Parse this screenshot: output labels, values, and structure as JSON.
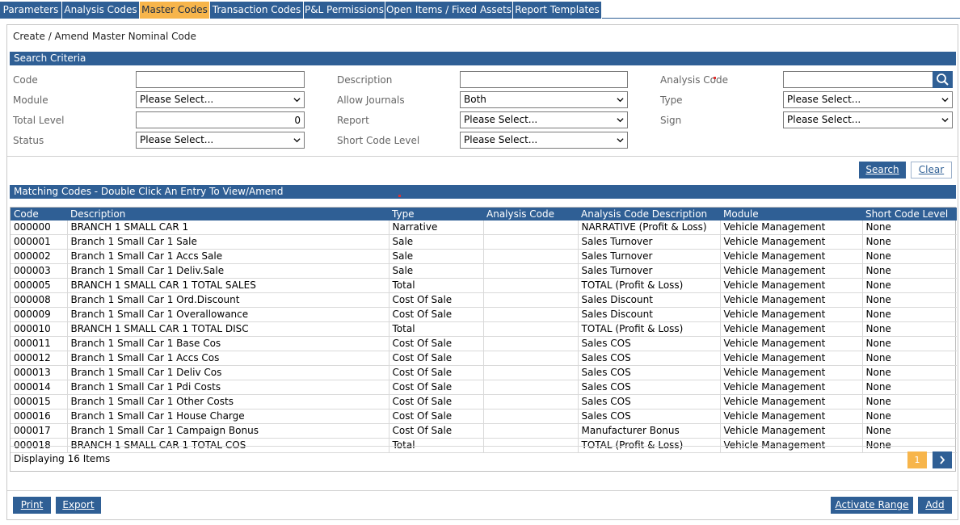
{
  "tabs": [
    {
      "label": "Parameters",
      "active": false
    },
    {
      "label": "Analysis Codes",
      "active": false
    },
    {
      "label": "Master Codes",
      "active": true
    },
    {
      "label": "Transaction Codes",
      "active": false
    },
    {
      "label": "P&L Permissions",
      "active": false
    },
    {
      "label": "Open Items / Fixed Assets",
      "active": false
    },
    {
      "label": "Report Templates",
      "active": false
    }
  ],
  "page_title": "Create / Amend Master Nominal Code",
  "search_criteria": {
    "header": "Search Criteria",
    "code": {
      "label": "Code",
      "value": ""
    },
    "description": {
      "label": "Description",
      "value": ""
    },
    "analysis_code": {
      "label": "Analysis Code",
      "value": ""
    },
    "module": {
      "label": "Module",
      "value": "Please Select..."
    },
    "allow_journals": {
      "label": "Allow Journals",
      "value": "Both"
    },
    "type": {
      "label": "Type",
      "value": "Please Select..."
    },
    "total_level": {
      "label": "Total Level",
      "value": "0"
    },
    "report": {
      "label": "Report",
      "value": "Please Select..."
    },
    "sign": {
      "label": "Sign",
      "value": "Please Select..."
    },
    "status": {
      "label": "Status",
      "value": "Please Select..."
    },
    "short_code_level": {
      "label": "Short Code Level",
      "value": "Please Select..."
    }
  },
  "actions": {
    "search_label": "Search",
    "clear_label": "Clear"
  },
  "matching": {
    "header": "Matching Codes - Double Click An Entry To View/Amend",
    "columns": [
      "Code",
      "Description",
      "Type",
      "Analysis Code",
      "Analysis Code Description",
      "Module",
      "Short Code Level"
    ],
    "rows": [
      [
        "000000",
        "BRANCH 1 SMALL CAR 1",
        "Narrative",
        "",
        "NARRATIVE (Profit & Loss)",
        "Vehicle Management",
        "None"
      ],
      [
        "000001",
        "Branch 1 Small Car 1 Sale",
        "Sale",
        "",
        "Sales Turnover",
        "Vehicle Management",
        "None"
      ],
      [
        "000002",
        "Branch 1 Small Car 1 Accs Sale",
        "Sale",
        "",
        "Sales Turnover",
        "Vehicle Management",
        "None"
      ],
      [
        "000003",
        "Branch 1 Small Car 1 Deliv.Sale",
        "Sale",
        "",
        "Sales Turnover",
        "Vehicle Management",
        "None"
      ],
      [
        "000005",
        "BRANCH 1 SMALL CAR 1 TOTAL SALES",
        "Total",
        "",
        "TOTAL (Profit & Loss)",
        "Vehicle Management",
        "None"
      ],
      [
        "000008",
        "Branch 1 Small Car 1 Ord.Discount",
        "Cost Of Sale",
        "",
        "Sales Discount",
        "Vehicle Management",
        "None"
      ],
      [
        "000009",
        "Branch 1 Small Car 1 Overallowance",
        "Cost Of Sale",
        "",
        "Sales Discount",
        "Vehicle Management",
        "None"
      ],
      [
        "000010",
        "BRANCH 1 SMALL CAR 1 TOTAL DISC",
        "Total",
        "",
        "TOTAL (Profit & Loss)",
        "Vehicle Management",
        "None"
      ],
      [
        "000011",
        "Branch 1 Small Car 1 Base Cos",
        "Cost Of Sale",
        "",
        "Sales COS",
        "Vehicle Management",
        "None"
      ],
      [
        "000012",
        "Branch 1 Small Car 1 Accs Cos",
        "Cost Of Sale",
        "",
        "Sales COS",
        "Vehicle Management",
        "None"
      ],
      [
        "000013",
        "Branch 1 Small Car 1 Deliv Cos",
        "Cost Of Sale",
        "",
        "Sales COS",
        "Vehicle Management",
        "None"
      ],
      [
        "000014",
        "Branch 1 Small Car 1 Pdi Costs",
        "Cost Of Sale",
        "",
        "Sales COS",
        "Vehicle Management",
        "None"
      ],
      [
        "000015",
        "Branch 1 Small Car 1 Other Costs",
        "Cost Of Sale",
        "",
        "Sales COS",
        "Vehicle Management",
        "None"
      ],
      [
        "000016",
        "Branch 1 Small Car 1 House Charge",
        "Cost Of Sale",
        "",
        "Sales COS",
        "Vehicle Management",
        "None"
      ],
      [
        "000017",
        "Branch 1 Small Car 1 Campaign Bonus",
        "Cost Of Sale",
        "",
        "Manufacturer Bonus",
        "Vehicle Management",
        "None"
      ],
      [
        "000018",
        "BRANCH 1 SMALL CAR 1 TOTAL COS",
        "Total",
        "",
        "TOTAL (Profit & Loss)",
        "Vehicle Management",
        "None"
      ]
    ],
    "count_label": "Displaying 16 Items",
    "current_page": "1"
  },
  "footer": {
    "print_label": "Print",
    "export_label": "Export",
    "activate_range_label": "Activate Range",
    "add_label": "Add"
  },
  "colors": {
    "primary": "#2f5f95",
    "active_tab": "#f7b54b",
    "required_marker": "#e0302f"
  }
}
